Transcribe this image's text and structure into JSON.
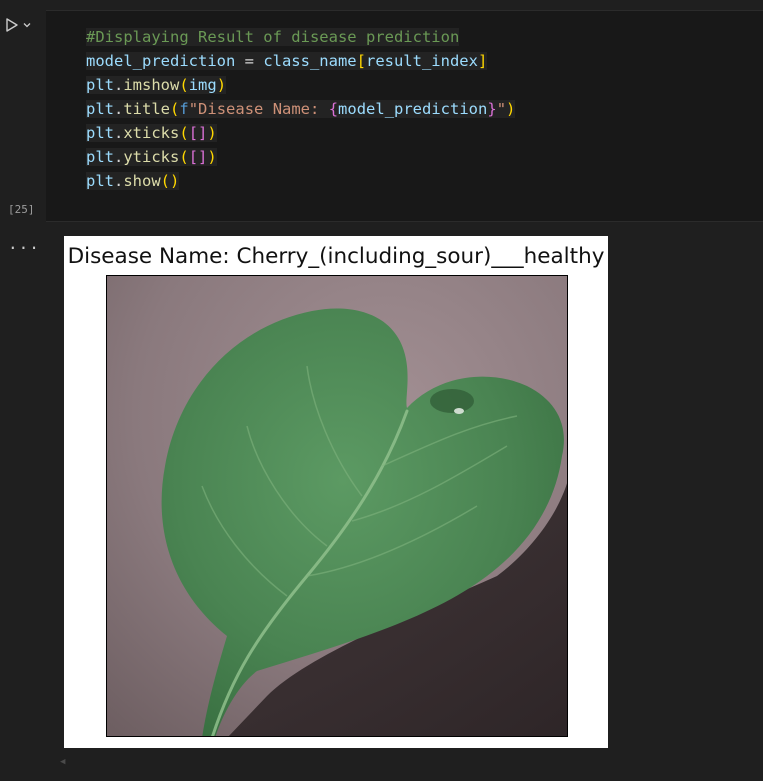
{
  "cell": {
    "execution_count": "[25]",
    "output_indicator": "...",
    "code_lines": [
      "#Displaying Result of disease prediction",
      "model_prediction = class_name[result_index]",
      "plt.imshow(img)",
      "plt.title(f\"Disease Name: {model_prediction}\")",
      "plt.xticks([])",
      "plt.yticks([])",
      "plt.show()"
    ]
  },
  "output": {
    "title": "Disease Name: Cherry_(including_sour)___healthy",
    "image_icon": "cherry-leaf-photo"
  },
  "colors": {
    "background": "#1f1f1f",
    "cell_background": "#181818",
    "comment": "#6a9955",
    "variable": "#9cdcfe",
    "function": "#dcdcaa",
    "string": "#ce9178"
  }
}
